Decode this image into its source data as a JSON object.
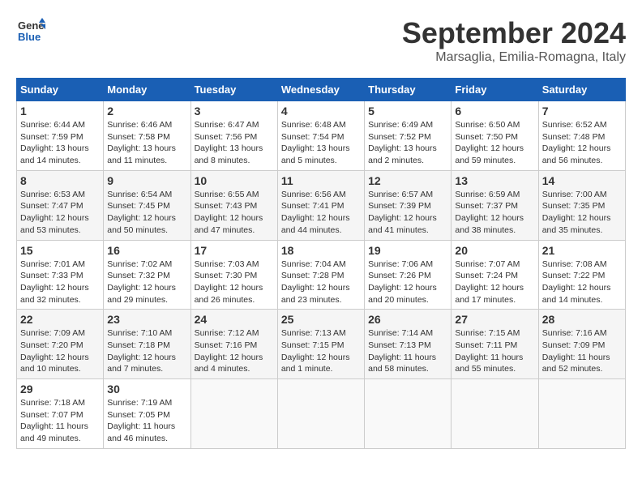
{
  "header": {
    "logo_line1": "General",
    "logo_line2": "Blue",
    "month_title": "September 2024",
    "location": "Marsaglia, Emilia-Romagna, Italy"
  },
  "calendar": {
    "days_of_week": [
      "Sunday",
      "Monday",
      "Tuesday",
      "Wednesday",
      "Thursday",
      "Friday",
      "Saturday"
    ],
    "weeks": [
      [
        {
          "day": "1",
          "info": "Sunrise: 6:44 AM\nSunset: 7:59 PM\nDaylight: 13 hours and 14 minutes."
        },
        {
          "day": "2",
          "info": "Sunrise: 6:46 AM\nSunset: 7:58 PM\nDaylight: 13 hours and 11 minutes."
        },
        {
          "day": "3",
          "info": "Sunrise: 6:47 AM\nSunset: 7:56 PM\nDaylight: 13 hours and 8 minutes."
        },
        {
          "day": "4",
          "info": "Sunrise: 6:48 AM\nSunset: 7:54 PM\nDaylight: 13 hours and 5 minutes."
        },
        {
          "day": "5",
          "info": "Sunrise: 6:49 AM\nSunset: 7:52 PM\nDaylight: 13 hours and 2 minutes."
        },
        {
          "day": "6",
          "info": "Sunrise: 6:50 AM\nSunset: 7:50 PM\nDaylight: 12 hours and 59 minutes."
        },
        {
          "day": "7",
          "info": "Sunrise: 6:52 AM\nSunset: 7:48 PM\nDaylight: 12 hours and 56 minutes."
        }
      ],
      [
        {
          "day": "8",
          "info": "Sunrise: 6:53 AM\nSunset: 7:47 PM\nDaylight: 12 hours and 53 minutes."
        },
        {
          "day": "9",
          "info": "Sunrise: 6:54 AM\nSunset: 7:45 PM\nDaylight: 12 hours and 50 minutes."
        },
        {
          "day": "10",
          "info": "Sunrise: 6:55 AM\nSunset: 7:43 PM\nDaylight: 12 hours and 47 minutes."
        },
        {
          "day": "11",
          "info": "Sunrise: 6:56 AM\nSunset: 7:41 PM\nDaylight: 12 hours and 44 minutes."
        },
        {
          "day": "12",
          "info": "Sunrise: 6:57 AM\nSunset: 7:39 PM\nDaylight: 12 hours and 41 minutes."
        },
        {
          "day": "13",
          "info": "Sunrise: 6:59 AM\nSunset: 7:37 PM\nDaylight: 12 hours and 38 minutes."
        },
        {
          "day": "14",
          "info": "Sunrise: 7:00 AM\nSunset: 7:35 PM\nDaylight: 12 hours and 35 minutes."
        }
      ],
      [
        {
          "day": "15",
          "info": "Sunrise: 7:01 AM\nSunset: 7:33 PM\nDaylight: 12 hours and 32 minutes."
        },
        {
          "day": "16",
          "info": "Sunrise: 7:02 AM\nSunset: 7:32 PM\nDaylight: 12 hours and 29 minutes."
        },
        {
          "day": "17",
          "info": "Sunrise: 7:03 AM\nSunset: 7:30 PM\nDaylight: 12 hours and 26 minutes."
        },
        {
          "day": "18",
          "info": "Sunrise: 7:04 AM\nSunset: 7:28 PM\nDaylight: 12 hours and 23 minutes."
        },
        {
          "day": "19",
          "info": "Sunrise: 7:06 AM\nSunset: 7:26 PM\nDaylight: 12 hours and 20 minutes."
        },
        {
          "day": "20",
          "info": "Sunrise: 7:07 AM\nSunset: 7:24 PM\nDaylight: 12 hours and 17 minutes."
        },
        {
          "day": "21",
          "info": "Sunrise: 7:08 AM\nSunset: 7:22 PM\nDaylight: 12 hours and 14 minutes."
        }
      ],
      [
        {
          "day": "22",
          "info": "Sunrise: 7:09 AM\nSunset: 7:20 PM\nDaylight: 12 hours and 10 minutes."
        },
        {
          "day": "23",
          "info": "Sunrise: 7:10 AM\nSunset: 7:18 PM\nDaylight: 12 hours and 7 minutes."
        },
        {
          "day": "24",
          "info": "Sunrise: 7:12 AM\nSunset: 7:16 PM\nDaylight: 12 hours and 4 minutes."
        },
        {
          "day": "25",
          "info": "Sunrise: 7:13 AM\nSunset: 7:15 PM\nDaylight: 12 hours and 1 minute."
        },
        {
          "day": "26",
          "info": "Sunrise: 7:14 AM\nSunset: 7:13 PM\nDaylight: 11 hours and 58 minutes."
        },
        {
          "day": "27",
          "info": "Sunrise: 7:15 AM\nSunset: 7:11 PM\nDaylight: 11 hours and 55 minutes."
        },
        {
          "day": "28",
          "info": "Sunrise: 7:16 AM\nSunset: 7:09 PM\nDaylight: 11 hours and 52 minutes."
        }
      ],
      [
        {
          "day": "29",
          "info": "Sunrise: 7:18 AM\nSunset: 7:07 PM\nDaylight: 11 hours and 49 minutes."
        },
        {
          "day": "30",
          "info": "Sunrise: 7:19 AM\nSunset: 7:05 PM\nDaylight: 11 hours and 46 minutes."
        },
        {
          "day": "",
          "info": ""
        },
        {
          "day": "",
          "info": ""
        },
        {
          "day": "",
          "info": ""
        },
        {
          "day": "",
          "info": ""
        },
        {
          "day": "",
          "info": ""
        }
      ]
    ]
  }
}
